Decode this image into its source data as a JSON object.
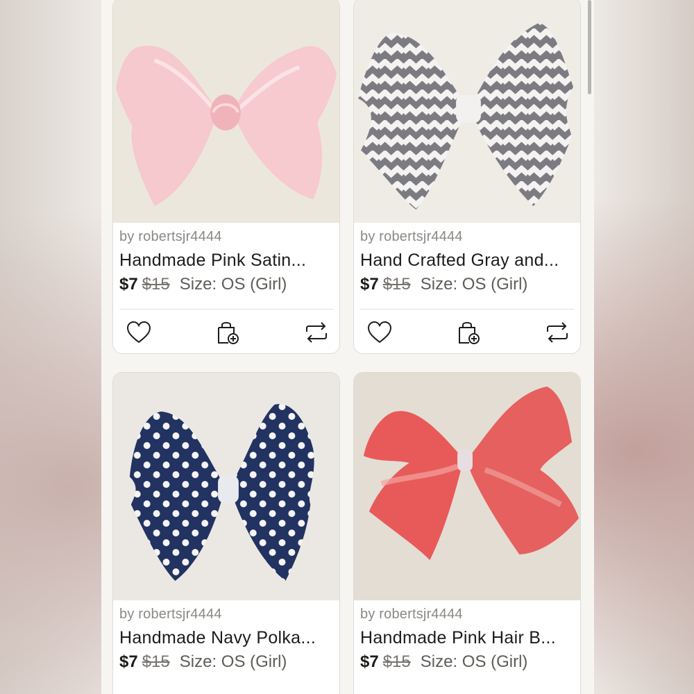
{
  "listings": [
    {
      "seller": "by robertsjr4444",
      "title": "Handmade Pink Satin...",
      "price": "$7",
      "original_price": "$15",
      "size": "Size: OS (Girl)"
    },
    {
      "seller": "by robertsjr4444",
      "title": "Hand Crafted Gray and...",
      "price": "$7",
      "original_price": "$15",
      "size": "Size: OS (Girl)"
    },
    {
      "seller": "by robertsjr4444",
      "title": "Handmade Navy Polka...",
      "price": "$7",
      "original_price": "$15",
      "size": "Size: OS (Girl)"
    },
    {
      "seller": "by robertsjr4444",
      "title": "Handmade Pink Hair B...",
      "price": "$7",
      "original_price": "$15",
      "size": "Size: OS (Girl)"
    }
  ],
  "icons": {
    "like": "heart-icon",
    "bundle": "shopping-bag-plus-icon",
    "share": "share-repost-icon"
  },
  "colors": {
    "text": "#1d1c1a",
    "muted": "#8b8985",
    "card": "#ffffff"
  }
}
